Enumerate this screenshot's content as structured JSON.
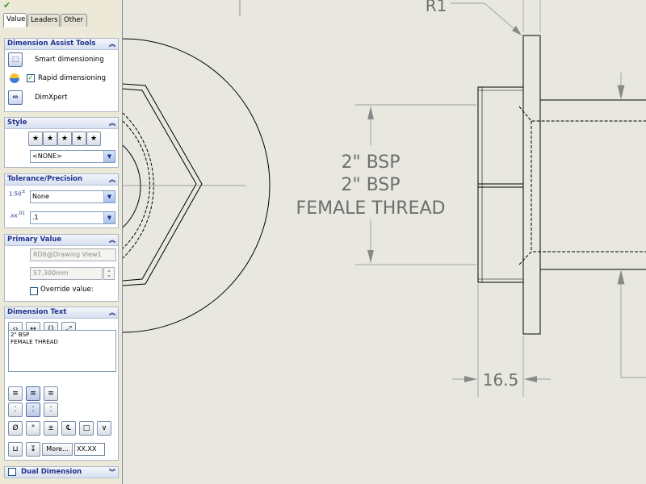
{
  "tabs": [
    {
      "label": "Value",
      "active": true
    },
    {
      "label": "Leaders",
      "active": false
    },
    {
      "label": "Other",
      "active": false
    }
  ],
  "assist": {
    "title": "Dimension Assist Tools",
    "smart": "Smart dimensioning",
    "rapid": "Rapid dimensioning",
    "rapid_checked": true,
    "dimxpert": "DimXpert"
  },
  "style": {
    "title": "Style",
    "value": "<NONE>"
  },
  "tolerance": {
    "title": "Tolerance/Precision",
    "type": "None",
    "precision": ".1"
  },
  "primary": {
    "title": "Primary Value",
    "name": "RD6@Drawing View1",
    "value": "57.300mm",
    "override_label": "Override value:",
    "override_checked": false
  },
  "dimtext": {
    "title": "Dimension Text",
    "text_line1": "2\" BSP",
    "text_line2": "FEMALE THREAD",
    "more_label": "More...",
    "xx_label": "XX.XX"
  },
  "dual": {
    "title": "Dual Dimension",
    "checked": false
  },
  "drawing": {
    "callout_1": "2\" BSP",
    "callout_2": "2\" BSP",
    "callout_3": "FEMALE THREAD",
    "dim_width": "16.5",
    "radius_label": "R1"
  },
  "colors": {
    "background": "#e8e8e0",
    "line": "#000000",
    "dim_text": "#6e6e6e",
    "panel": "#ece9d8",
    "group_header": "#21348c"
  }
}
